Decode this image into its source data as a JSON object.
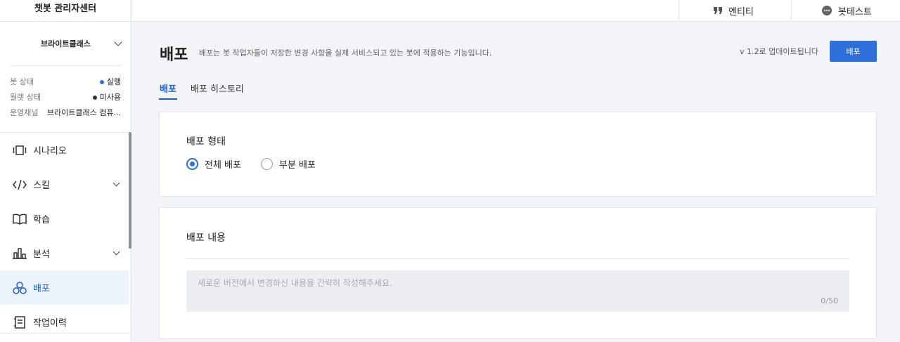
{
  "app": {
    "title": "챗봇 관리자센터"
  },
  "topbar": {
    "entity_label": "엔티티",
    "bottest_label": "봇테스트"
  },
  "bot": {
    "name": "브라이트클래스",
    "status_label": "봇 상태",
    "status_value": "실행",
    "wallet_label": "월렛 상태",
    "wallet_value": "미사용",
    "channel_label": "운영채널",
    "channel_value": "브라이트클래스 컴퓨..."
  },
  "nav": {
    "items": [
      {
        "label": "시나리오",
        "icon": "scenario-icon",
        "active": false
      },
      {
        "label": "스킬",
        "icon": "code-icon",
        "active": false
      },
      {
        "label": "학습",
        "icon": "book-icon",
        "active": false
      },
      {
        "label": "분석",
        "icon": "chart-icon",
        "active": false
      },
      {
        "label": "배포",
        "icon": "deploy-icon",
        "active": true
      },
      {
        "label": "작업이력",
        "icon": "history-icon",
        "active": false
      }
    ]
  },
  "page": {
    "title": "배포",
    "description": "배포는 봇 작업자들이 저장한 변경 사항을 실제 서비스되고 있는 봇에 적용하는 기능입니다.",
    "version_text": "v 1.2로 업데이트됩니다",
    "deploy_button": "배포"
  },
  "tabs": [
    {
      "label": "배포",
      "active": true
    },
    {
      "label": "배포 히스토리",
      "active": false
    }
  ],
  "deploy_type": {
    "title": "배포 형태",
    "options": [
      {
        "label": "전체 배포",
        "checked": true
      },
      {
        "label": "부분 배포",
        "checked": false
      }
    ]
  },
  "deploy_content": {
    "title": "배포 내용",
    "placeholder": "새로운 버전에서 변경하신 내용을 간략히 작성해주세요.",
    "value": "",
    "counter": "0/50"
  },
  "colors": {
    "accent": "#2f6fdc",
    "active_nav_bg": "#edf3fd",
    "page_bg": "#f3f4f8"
  }
}
